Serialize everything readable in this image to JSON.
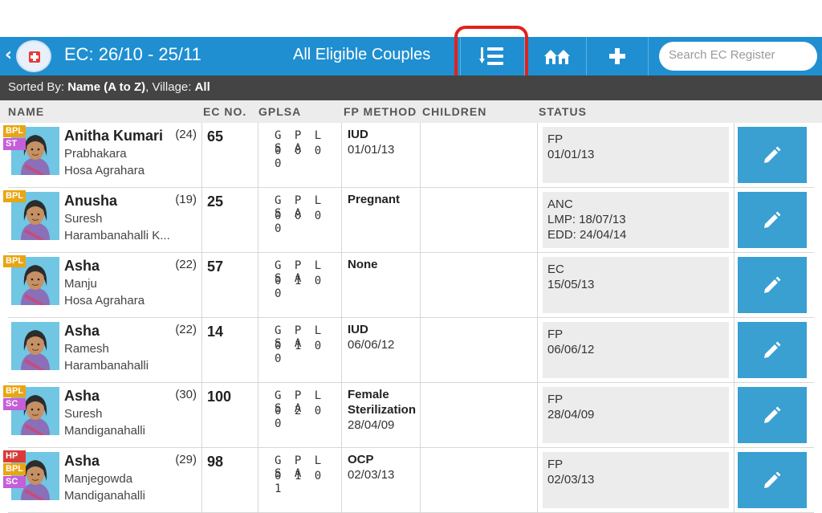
{
  "header": {
    "back_glyph": "‹",
    "logo_icon": "health-logo-icon",
    "title": "EC: 26/10 - 25/11",
    "center_title": "All Eligible Couples",
    "sort_icon": "sort-list-icon",
    "village_icon": "village-houses-icon",
    "add_icon": "plus-icon",
    "search_placeholder": "Search EC Register",
    "highlight_color": "#e3211c",
    "bar_color": "#1f8fd1"
  },
  "sortbar": {
    "prefix": "Sorted By: ",
    "sort_value": "Name (A to Z)",
    "village_prefix": ", Village: ",
    "village_value": "All"
  },
  "columns": {
    "name": "NAME",
    "ec_no": "EC NO.",
    "gplsa": "GPLSA",
    "fp_method": "FP METHOD",
    "children": "CHILDREN",
    "status": "STATUS"
  },
  "rows": [
    {
      "tags": [
        "BPL",
        "ST"
      ],
      "name": "Anitha Kumari",
      "age": "(24)",
      "husband": "Prabhakara",
      "village": "Hosa Agrahara",
      "ec_no": "65",
      "gplsa_header": "G P L S A",
      "gplsa_values": "0 0 0 0",
      "fp1": "IUD",
      "fp2": "01/01/13",
      "fp3": "",
      "status": [
        "FP",
        "01/01/13"
      ]
    },
    {
      "tags": [
        "BPL"
      ],
      "name": "Anusha",
      "age": "(19)",
      "husband": "Suresh",
      "village": "Harambanahalli K...",
      "ec_no": "25",
      "gplsa_header": "G P L S A",
      "gplsa_values": "0 0 0 0",
      "fp1": "Pregnant",
      "fp2": "",
      "fp3": "",
      "status": [
        "ANC",
        "LMP: 18/07/13",
        "EDD: 24/04/14"
      ]
    },
    {
      "tags": [
        "BPL"
      ],
      "name": "Asha",
      "age": "(22)",
      "husband": "Manju",
      "village": "Hosa Agrahara",
      "ec_no": "57",
      "gplsa_header": "G P L S A",
      "gplsa_values": "0 1 0 0",
      "fp1": "None",
      "fp2": "",
      "fp3": "",
      "status": [
        "EC",
        "15/05/13"
      ]
    },
    {
      "tags": [],
      "name": "Asha",
      "age": "(22)",
      "husband": "Ramesh",
      "village": "Harambanahalli",
      "ec_no": "14",
      "gplsa_header": "G P L S A",
      "gplsa_values": "0 1 0 0",
      "fp1": "IUD",
      "fp2": "06/06/12",
      "fp3": "",
      "status": [
        "FP",
        "06/06/12"
      ]
    },
    {
      "tags": [
        "BPL",
        "SC"
      ],
      "name": "Asha",
      "age": "(30)",
      "husband": "Suresh",
      "village": "Mandiganahalli",
      "ec_no": "100",
      "gplsa_header": "G P L S A",
      "gplsa_values": "0 2 0 0",
      "fp1": "Female",
      "fp2": "Sterilization",
      "fp3": "28/04/09",
      "status": [
        "FP",
        "28/04/09"
      ]
    },
    {
      "tags": [
        "HP",
        "BPL",
        "SC"
      ],
      "name": "Asha",
      "age": "(29)",
      "husband": "Manjegowda",
      "village": "Mandiganahalli",
      "ec_no": "98",
      "gplsa_header": "G P L S A",
      "gplsa_values": "0 1 0 1",
      "fp1": "OCP",
      "fp2": "02/03/13",
      "fp3": "",
      "status": [
        "FP",
        "02/03/13"
      ]
    }
  ]
}
